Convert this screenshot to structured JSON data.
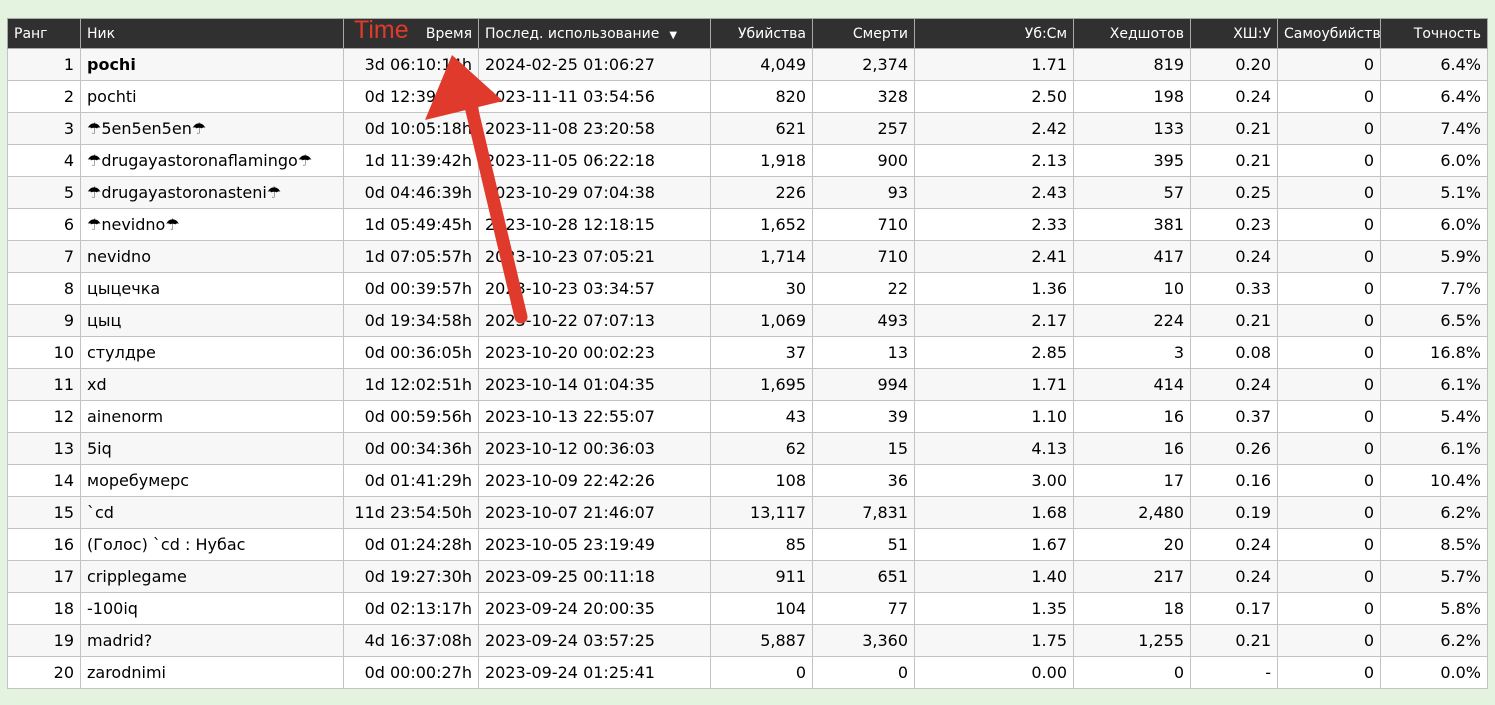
{
  "annotation": {
    "label": "Time",
    "color": "#e03a2c"
  },
  "columns": {
    "rank": "Ранг",
    "nick": "Ник",
    "time": "Время",
    "last": "Послед. использование",
    "last_sort": "▼",
    "kills": "Убийства",
    "deaths": "Смерти",
    "kd": "Уб:См",
    "hs": "Хедшотов",
    "hsk": "ХШ:У",
    "suicides": "Самоубийств",
    "accuracy": "Точность"
  },
  "rows": [
    {
      "rank": "1",
      "nick": "pochi",
      "time": "3d 06:10:14h",
      "last": "2024-02-25 01:06:27",
      "kills": "4,049",
      "deaths": "2,374",
      "kd": "1.71",
      "hs": "819",
      "hsk": "0.20",
      "suicides": "0",
      "accuracy": "6.4%"
    },
    {
      "rank": "2",
      "nick": "pochti",
      "time": "0d 12:39:52h",
      "last": "2023-11-11 03:54:56",
      "kills": "820",
      "deaths": "328",
      "kd": "2.50",
      "hs": "198",
      "hsk": "0.24",
      "suicides": "0",
      "accuracy": "6.4%"
    },
    {
      "rank": "3",
      "nick": "☂5en5en5en☂",
      "time": "0d 10:05:18h",
      "last": "2023-11-08 23:20:58",
      "kills": "621",
      "deaths": "257",
      "kd": "2.42",
      "hs": "133",
      "hsk": "0.21",
      "suicides": "0",
      "accuracy": "7.4%"
    },
    {
      "rank": "4",
      "nick": "☂drugayastoronaflamingo☂",
      "time": "1d 11:39:42h",
      "last": "2023-11-05 06:22:18",
      "kills": "1,918",
      "deaths": "900",
      "kd": "2.13",
      "hs": "395",
      "hsk": "0.21",
      "suicides": "0",
      "accuracy": "6.0%"
    },
    {
      "rank": "5",
      "nick": "☂drugayastoronasteni☂",
      "time": "0d 04:46:39h",
      "last": "2023-10-29 07:04:38",
      "kills": "226",
      "deaths": "93",
      "kd": "2.43",
      "hs": "57",
      "hsk": "0.25",
      "suicides": "0",
      "accuracy": "5.1%"
    },
    {
      "rank": "6",
      "nick": "☂nevidno☂",
      "time": "1d 05:49:45h",
      "last": "2023-10-28 12:18:15",
      "kills": "1,652",
      "deaths": "710",
      "kd": "2.33",
      "hs": "381",
      "hsk": "0.23",
      "suicides": "0",
      "accuracy": "6.0%"
    },
    {
      "rank": "7",
      "nick": "nevidno",
      "time": "1d 07:05:57h",
      "last": "2023-10-23 07:05:21",
      "kills": "1,714",
      "deaths": "710",
      "kd": "2.41",
      "hs": "417",
      "hsk": "0.24",
      "suicides": "0",
      "accuracy": "5.9%"
    },
    {
      "rank": "8",
      "nick": "цыцечка",
      "time": "0d 00:39:57h",
      "last": "2023-10-23 03:34:57",
      "kills": "30",
      "deaths": "22",
      "kd": "1.36",
      "hs": "10",
      "hsk": "0.33",
      "suicides": "0",
      "accuracy": "7.7%"
    },
    {
      "rank": "9",
      "nick": "цыц",
      "time": "0d 19:34:58h",
      "last": "2023-10-22 07:07:13",
      "kills": "1,069",
      "deaths": "493",
      "kd": "2.17",
      "hs": "224",
      "hsk": "0.21",
      "suicides": "0",
      "accuracy": "6.5%"
    },
    {
      "rank": "10",
      "nick": "стулдре",
      "time": "0d 00:36:05h",
      "last": "2023-10-20 00:02:23",
      "kills": "37",
      "deaths": "13",
      "kd": "2.85",
      "hs": "3",
      "hsk": "0.08",
      "suicides": "0",
      "accuracy": "16.8%"
    },
    {
      "rank": "11",
      "nick": "xd",
      "time": "1d 12:02:51h",
      "last": "2023-10-14 01:04:35",
      "kills": "1,695",
      "deaths": "994",
      "kd": "1.71",
      "hs": "414",
      "hsk": "0.24",
      "suicides": "0",
      "accuracy": "6.1%"
    },
    {
      "rank": "12",
      "nick": "ainenorm",
      "time": "0d 00:59:56h",
      "last": "2023-10-13 22:55:07",
      "kills": "43",
      "deaths": "39",
      "kd": "1.10",
      "hs": "16",
      "hsk": "0.37",
      "suicides": "0",
      "accuracy": "5.4%"
    },
    {
      "rank": "13",
      "nick": "5iq",
      "time": "0d 00:34:36h",
      "last": "2023-10-12 00:36:03",
      "kills": "62",
      "deaths": "15",
      "kd": "4.13",
      "hs": "16",
      "hsk": "0.26",
      "suicides": "0",
      "accuracy": "6.1%"
    },
    {
      "rank": "14",
      "nick": "моребумерс",
      "time": "0d 01:41:29h",
      "last": "2023-10-09 22:42:26",
      "kills": "108",
      "deaths": "36",
      "kd": "3.00",
      "hs": "17",
      "hsk": "0.16",
      "suicides": "0",
      "accuracy": "10.4%"
    },
    {
      "rank": "15",
      "nick": "`cd",
      "time": "11d 23:54:50h",
      "last": "2023-10-07 21:46:07",
      "kills": "13,117",
      "deaths": "7,831",
      "kd": "1.68",
      "hs": "2,480",
      "hsk": "0.19",
      "suicides": "0",
      "accuracy": "6.2%"
    },
    {
      "rank": "16",
      "nick": "(Голос) `cd : Нубас",
      "time": "0d 01:24:28h",
      "last": "2023-10-05 23:19:49",
      "kills": "85",
      "deaths": "51",
      "kd": "1.67",
      "hs": "20",
      "hsk": "0.24",
      "suicides": "0",
      "accuracy": "8.5%"
    },
    {
      "rank": "17",
      "nick": "cripplegame",
      "time": "0d 19:27:30h",
      "last": "2023-09-25 00:11:18",
      "kills": "911",
      "deaths": "651",
      "kd": "1.40",
      "hs": "217",
      "hsk": "0.24",
      "suicides": "0",
      "accuracy": "5.7%"
    },
    {
      "rank": "18",
      "nick": "-100iq",
      "time": "0d 02:13:17h",
      "last": "2023-09-24 20:00:35",
      "kills": "104",
      "deaths": "77",
      "kd": "1.35",
      "hs": "18",
      "hsk": "0.17",
      "suicides": "0",
      "accuracy": "5.8%"
    },
    {
      "rank": "19",
      "nick": "madrid?",
      "time": "4d 16:37:08h",
      "last": "2023-09-24 03:57:25",
      "kills": "5,887",
      "deaths": "3,360",
      "kd": "1.75",
      "hs": "1,255",
      "hsk": "0.21",
      "suicides": "0",
      "accuracy": "6.2%"
    },
    {
      "rank": "20",
      "nick": "zarodnimi",
      "time": "0d 00:00:27h",
      "last": "2023-09-24 01:25:41",
      "kills": "0",
      "deaths": "0",
      "kd": "0.00",
      "hs": "0",
      "hsk": "-",
      "suicides": "0",
      "accuracy": "0.0%"
    }
  ]
}
